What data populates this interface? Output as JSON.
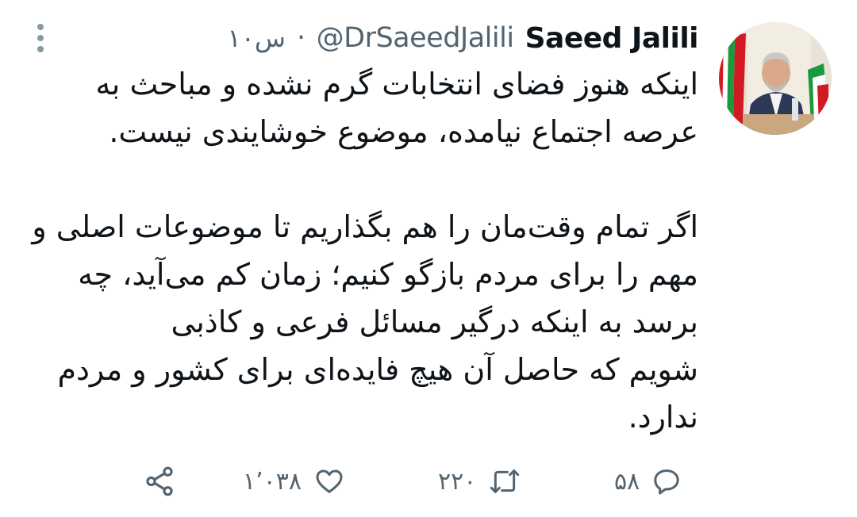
{
  "tweet": {
    "display_name": "Saeed Jalili",
    "handle": "@DrSaeedJalili",
    "separator": "·",
    "time": "۱۰س",
    "text": "اینکه هنوز فضای انتخابات گرم نشده و مباحث به عرصه اجتماع نیامده، موضوع خوشایندی نیست.\n\nاگر تمام وقت‌مان را هم بگذاریم تا موضوعات اصلی و مهم را برای مردم بازگو کنیم؛ زمان کم می‌آید، چه برسد به اینکه درگیر مسائل فرعی و کاذبی\nشویم که حاصل آن هیچ فایده‌ای برای کشور و مردم ندارد."
  },
  "actions": {
    "reply": {
      "icon": "reply-icon",
      "count": "۵۸"
    },
    "retweet": {
      "icon": "retweet-icon",
      "count": "۲۲۰"
    },
    "like": {
      "icon": "heart-icon",
      "count": "۱٬۰۳۸"
    },
    "share": {
      "icon": "share-icon"
    }
  },
  "colors": {
    "text": "#0f1419",
    "secondary": "#536471",
    "background": "#ffffff"
  }
}
